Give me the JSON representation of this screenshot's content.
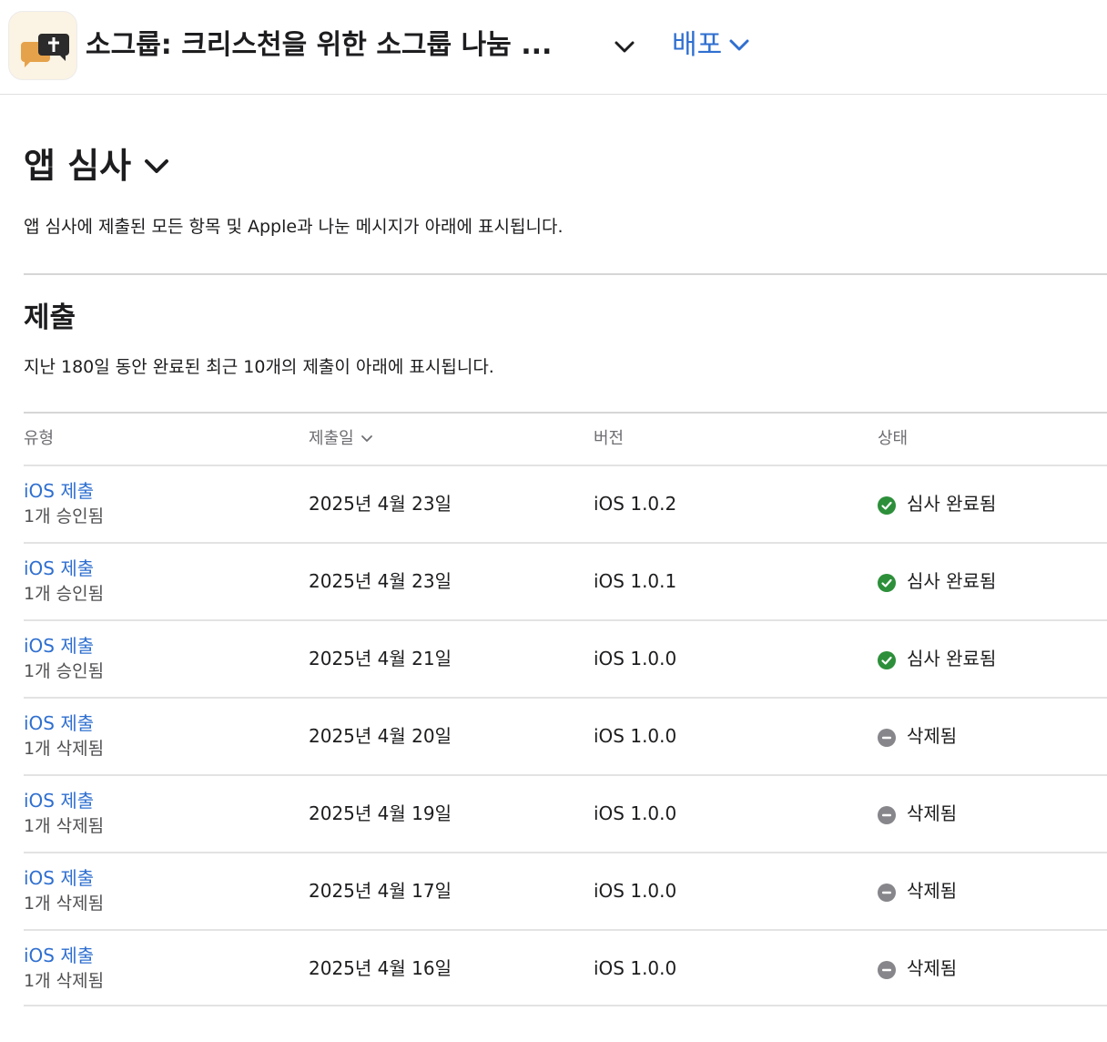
{
  "header": {
    "app_title": "소그룹: 크리스천을 위한 소그룹 나눔 ...",
    "distribute_label": "배포",
    "accent_color": "#2f6fd0"
  },
  "review": {
    "title": "앱 심사",
    "description": "앱 심사에 제출된 모든 항목 및 Apple과 나눈 메시지가 아래에 표시됩니다."
  },
  "submissions": {
    "title": "제출",
    "description": "지난 180일 동안 완료된 최근 10개의 제출이 아래에 표시됩니다.",
    "columns": {
      "type": "유형",
      "date": "제출일",
      "version": "버전",
      "status": "상태"
    },
    "rows": [
      {
        "type": "iOS 제출",
        "sub": "1개 승인됨",
        "date": "2025년 4월 23일",
        "version": "iOS 1.0.2",
        "status": "심사 완료됨",
        "status_kind": "complete"
      },
      {
        "type": "iOS 제출",
        "sub": "1개 승인됨",
        "date": "2025년 4월 23일",
        "version": "iOS 1.0.1",
        "status": "심사 완료됨",
        "status_kind": "complete"
      },
      {
        "type": "iOS 제출",
        "sub": "1개 승인됨",
        "date": "2025년 4월 21일",
        "version": "iOS 1.0.0",
        "status": "심사 완료됨",
        "status_kind": "complete"
      },
      {
        "type": "iOS 제출",
        "sub": "1개 삭제됨",
        "date": "2025년 4월 20일",
        "version": "iOS 1.0.0",
        "status": "삭제됨",
        "status_kind": "removed"
      },
      {
        "type": "iOS 제출",
        "sub": "1개 삭제됨",
        "date": "2025년 4월 19일",
        "version": "iOS 1.0.0",
        "status": "삭제됨",
        "status_kind": "removed"
      },
      {
        "type": "iOS 제출",
        "sub": "1개 삭제됨",
        "date": "2025년 4월 17일",
        "version": "iOS 1.0.0",
        "status": "삭제됨",
        "status_kind": "removed"
      },
      {
        "type": "iOS 제출",
        "sub": "1개 삭제됨",
        "date": "2025년 4월 16일",
        "version": "iOS 1.0.0",
        "status": "삭제됨",
        "status_kind": "removed"
      }
    ],
    "status_colors": {
      "complete": "#2d8f3a",
      "removed": "#86868b"
    }
  }
}
